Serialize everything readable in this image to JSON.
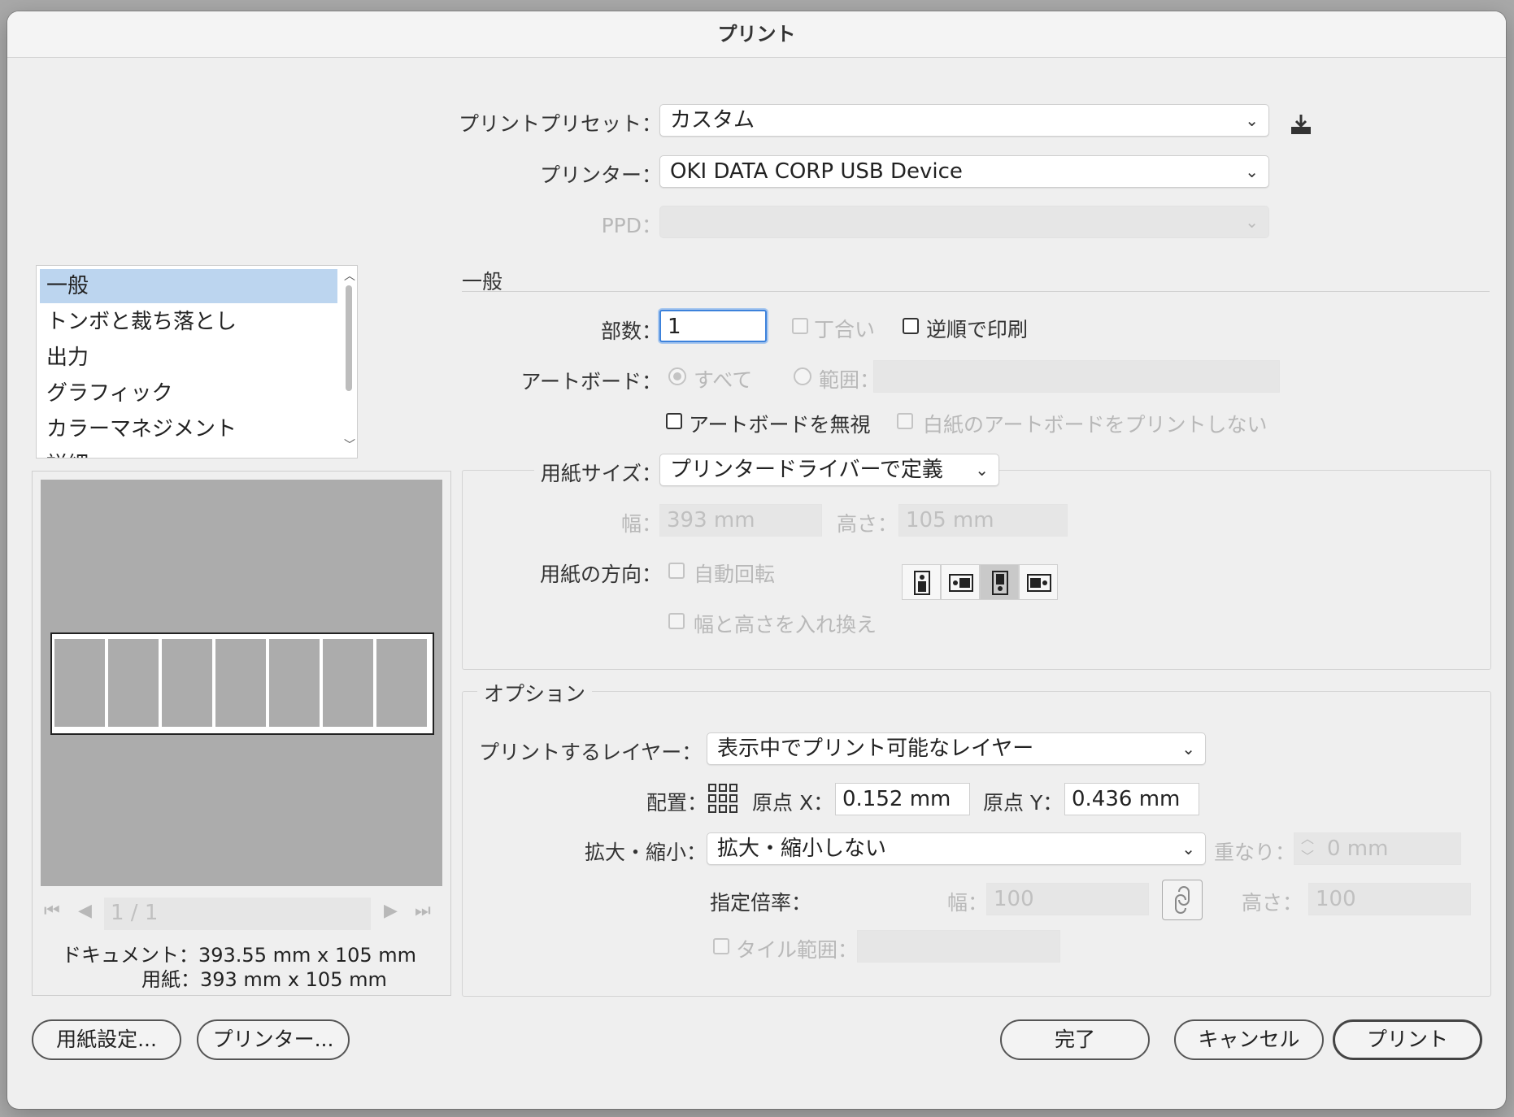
{
  "window": {
    "title": "プリント"
  },
  "top": {
    "preset_label": "プリントプリセット：",
    "preset_value": "カスタム",
    "printer_label": "プリンター：",
    "printer_value": "OKI DATA CORP USB Device",
    "ppd_label": "PPD："
  },
  "sidebar": {
    "items": [
      {
        "label": "一般"
      },
      {
        "label": "トンボと裁ち落とし"
      },
      {
        "label": "出力"
      },
      {
        "label": "グラフィック"
      },
      {
        "label": "カラーマネジメント"
      },
      {
        "label": "詳細"
      }
    ]
  },
  "preview": {
    "page_indicator": "1 / 1",
    "document_size": "ドキュメント：393.55 mm x 105 mm",
    "paper_size": "用紙：393 mm x 105 mm"
  },
  "general": {
    "section_title": "一般",
    "copies_label": "部数：",
    "copies_value": "1",
    "collate_label": "丁合い",
    "reverse_label": "逆順で印刷",
    "artboard_label": "アートボード：",
    "all_label": "すべて",
    "range_label": "範囲：",
    "ignore_artboards_label": "アートボードを無視",
    "skip_blank_label": "白紙のアートボードをプリントしない"
  },
  "paper": {
    "size_label": "用紙サイズ：",
    "size_value": "プリンタードライバーで定義",
    "width_label": "幅：",
    "width_value": "393 mm",
    "height_label": "高さ：",
    "height_value": "105 mm",
    "orientation_label": "用紙の方向：",
    "auto_rotate_label": "自動回転",
    "transverse_label": "幅と高さを入れ換え"
  },
  "options": {
    "section_title": "オプション",
    "layers_label": "プリントするレイヤー：",
    "layers_value": "表示中でプリント可能なレイヤー",
    "placement_label": "配置：",
    "origin_x_label": "原点 X：",
    "origin_x_value": "0.152 mm",
    "origin_y_label": "原点 Y：",
    "origin_y_value": "0.436 mm",
    "scaling_label": "拡大・縮小：",
    "scaling_value": "拡大・縮小しない",
    "overlap_label": "重なり：",
    "overlap_value": "0 mm",
    "custom_scale_label": "指定倍率：",
    "scale_width_label": "幅：",
    "scale_width_value": "100",
    "scale_height_label": "高さ：",
    "scale_height_value": "100",
    "tile_range_label": "タイル範囲："
  },
  "buttons": {
    "page_setup": "用紙設定...",
    "printer": "プリンター...",
    "done": "完了",
    "cancel": "キャンセル",
    "print": "プリント"
  },
  "colors": {
    "selection": "#bcd5ef",
    "dialog_bg": "#efefef",
    "preview_bg": "#acacac"
  }
}
